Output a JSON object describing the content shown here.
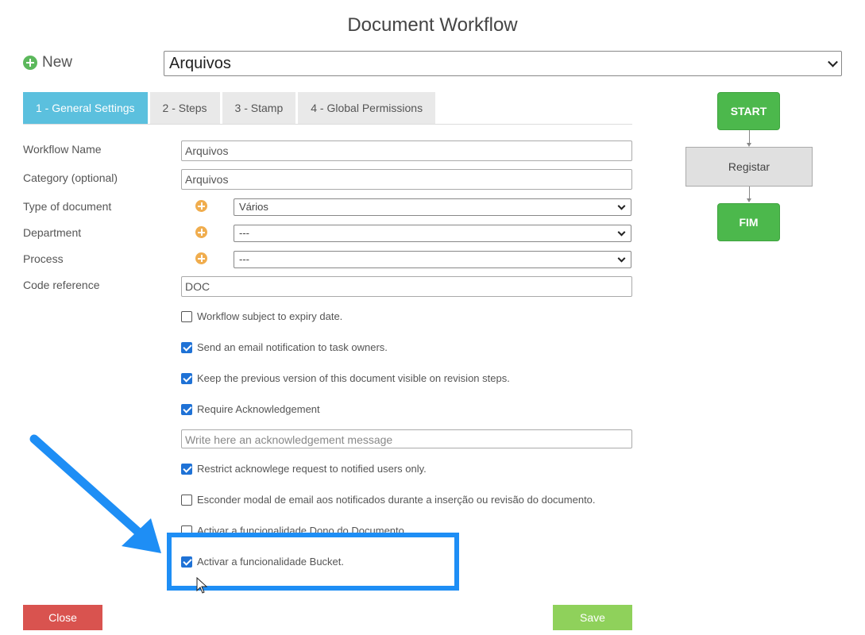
{
  "title": "Document Workflow",
  "new_label": "New",
  "workflow_select": "Arquivos",
  "tabs": [
    {
      "label": "1 - General Settings",
      "active": true
    },
    {
      "label": "2 - Steps",
      "active": false
    },
    {
      "label": "3 - Stamp",
      "active": false
    },
    {
      "label": "4 - Global Permissions",
      "active": false
    }
  ],
  "fields": {
    "workflow_name": {
      "label": "Workflow Name",
      "value": "Arquivos"
    },
    "category": {
      "label": "Category (optional)",
      "value": "Arquivos"
    },
    "type_of_document": {
      "label": "Type of document",
      "value": "Vários"
    },
    "department": {
      "label": "Department",
      "value": "---"
    },
    "process": {
      "label": "Process",
      "value": "---"
    },
    "code_reference": {
      "label": "Code reference",
      "value": "DOC"
    }
  },
  "checkboxes": [
    {
      "label": "Workflow subject to expiry date.",
      "checked": false
    },
    {
      "label": "Send an email notification to task owners.",
      "checked": true
    },
    {
      "label": "Keep the previous version of this document visible on revision steps.",
      "checked": true
    },
    {
      "label": "Require Acknowledgement",
      "checked": true
    },
    {
      "label": "Restrict acknowlege request to notified users only.",
      "checked": true
    },
    {
      "label": "Esconder modal de email aos notificados durante a inserção ou revisão do documento.",
      "checked": false
    },
    {
      "label": "Activar a funcionalidade Dono do Documento",
      "checked": false
    },
    {
      "label": "Activar a funcionalidade Bucket.",
      "checked": true
    }
  ],
  "ack_message_placeholder": "Write here an acknowledgement message",
  "buttons": {
    "close": "Close",
    "save": "Save"
  },
  "diagram": {
    "start": "START",
    "step": "Registar",
    "end": "FIM"
  },
  "colors": {
    "tab_active": "#5bc0de",
    "close": "#d9534f",
    "save": "#8fd15b",
    "node_green": "#4cb84c",
    "highlight": "#1e8ef5"
  }
}
